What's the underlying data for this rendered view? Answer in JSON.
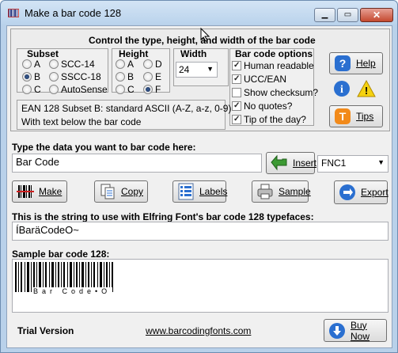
{
  "window": {
    "title": "Make a bar code 128"
  },
  "controls_panel": {
    "heading": "Control the type, height, and width of the bar code",
    "subset": {
      "label": "Subset",
      "options": [
        "A",
        "B",
        "C",
        "SCC-14",
        "SSCC-18",
        "AutoSense"
      ],
      "selected": "B"
    },
    "height": {
      "label": "Height",
      "options": [
        "A",
        "B",
        "C",
        "D",
        "E",
        "F"
      ],
      "selected": "F"
    },
    "width": {
      "label": "Width",
      "value": "24"
    },
    "options": {
      "label": "Bar code options",
      "items": [
        {
          "label": "Human readable",
          "checked": true
        },
        {
          "label": "UCC/EAN",
          "checked": true
        },
        {
          "label": "Show checksum?",
          "checked": false
        },
        {
          "label": "No quotes?",
          "checked": true
        },
        {
          "label": "Tip of the day?",
          "checked": true
        }
      ]
    },
    "info_text": {
      "line1": "EAN 128 Subset B:  standard ASCII (A-Z, a-z, 0-9)",
      "line2": "With text below the bar code"
    },
    "help_label": "Help",
    "tips_label": "Tips"
  },
  "data_entry": {
    "label": "Type the data you want to bar code here:",
    "value": "Bar Code",
    "insert_label": "Insert",
    "fnc_value": "FNC1"
  },
  "toolbar": {
    "make": "Make",
    "copy": "Copy",
    "labels": "Labels",
    "sample": "Sample",
    "export": "Export"
  },
  "output": {
    "label": "This is the string to use with Elfring Font's bar code 128 typefaces:",
    "value": "ÍBaräCodeO~"
  },
  "sample": {
    "label": "Sample bar code 128:",
    "human_text": "Bar Code•O"
  },
  "footer": {
    "trial": "Trial Version",
    "link": "www.barcodingfonts.com",
    "buy": "Buy Now"
  },
  "colors": {
    "help_blue": "#2a6fd0",
    "tips_orange": "#f28a1a",
    "warn_yellow": "#f5d210",
    "insert_green": "#3c9a33"
  }
}
